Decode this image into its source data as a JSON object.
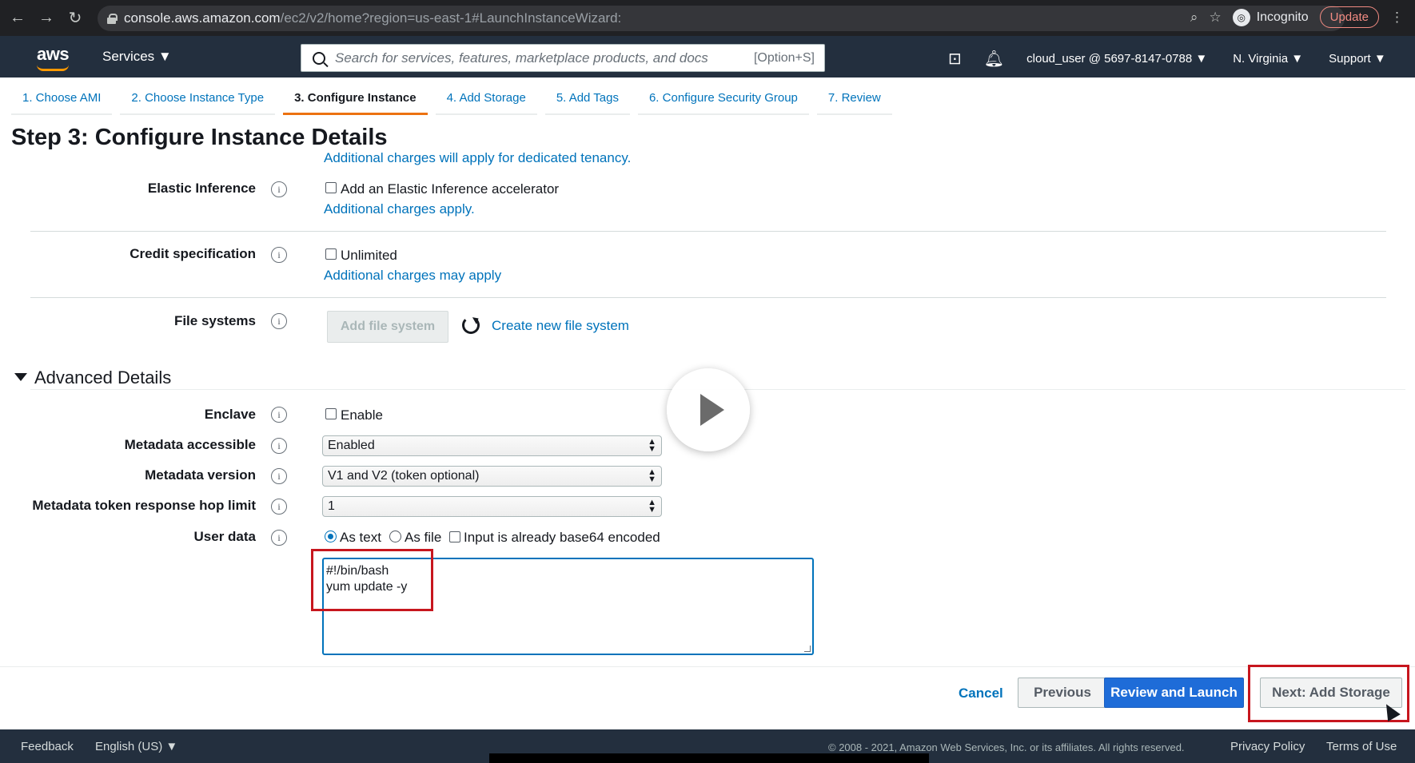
{
  "browser": {
    "url_host": "console.aws.amazon.com",
    "url_path": "/ec2/v2/home?region=us-east-1#LaunchInstanceWizard:",
    "incognito_label": "Incognito",
    "update_label": "Update"
  },
  "aws_nav": {
    "logo": "aws",
    "services_label": "Services ▼",
    "search_placeholder": "Search for services, features, marketplace products, and docs",
    "search_shortcut": "[Option+S]",
    "account": "cloud_user @ 5697-8147-0788 ▼",
    "region": "N. Virginia ▼",
    "support": "Support ▼"
  },
  "tabs": [
    {
      "label": "1. Choose AMI"
    },
    {
      "label": "2. Choose Instance Type"
    },
    {
      "label": "3. Configure Instance",
      "active": true
    },
    {
      "label": "4. Add Storage"
    },
    {
      "label": "5. Add Tags"
    },
    {
      "label": "6. Configure Security Group"
    },
    {
      "label": "7. Review"
    }
  ],
  "page_title": "Step 3: Configure Instance Details",
  "tenancy_note": "Additional charges will apply for dedicated tenancy.",
  "elastic_inference": {
    "label": "Elastic Inference",
    "checkbox_label": "Add an Elastic Inference accelerator",
    "link": "Additional charges apply."
  },
  "credit_spec": {
    "label": "Credit specification",
    "checkbox_label": "Unlimited",
    "link": "Additional charges may apply"
  },
  "file_systems": {
    "label": "File systems",
    "add_button": "Add file system",
    "create_link": "Create new file system"
  },
  "advanced": {
    "title": "Advanced Details",
    "enclave_label": "Enclave",
    "enclave_checkbox": "Enable",
    "metadata_accessible_label": "Metadata accessible",
    "metadata_accessible_value": "Enabled",
    "metadata_version_label": "Metadata version",
    "metadata_version_value": "V1 and V2 (token optional)",
    "hop_limit_label": "Metadata token response hop limit",
    "hop_limit_value": "1",
    "user_data_label": "User data",
    "radio_as_text": "As text",
    "radio_as_file": "As file",
    "base64_checkbox": "Input is already base64 encoded",
    "user_data_line1": "#!/bin/bash",
    "user_data_line2": "yum update -y"
  },
  "actions": {
    "cancel": "Cancel",
    "previous": "Previous",
    "review_launch": "Review and Launch",
    "next": "Next: Add Storage"
  },
  "footer": {
    "feedback": "Feedback",
    "language": "English (US) ▼",
    "copyright": "© 2008 - 2021, Amazon Web Services, Inc. or its affiliates. All rights reserved.",
    "privacy": "Privacy Policy",
    "terms": "Terms of Use"
  },
  "colors": {
    "aws_nav_bg": "#232f3e",
    "link_blue": "#0073bb",
    "primary_button": "#1e6cd8",
    "active_tab_accent": "#ec7211",
    "highlight_red": "#c7161e"
  }
}
